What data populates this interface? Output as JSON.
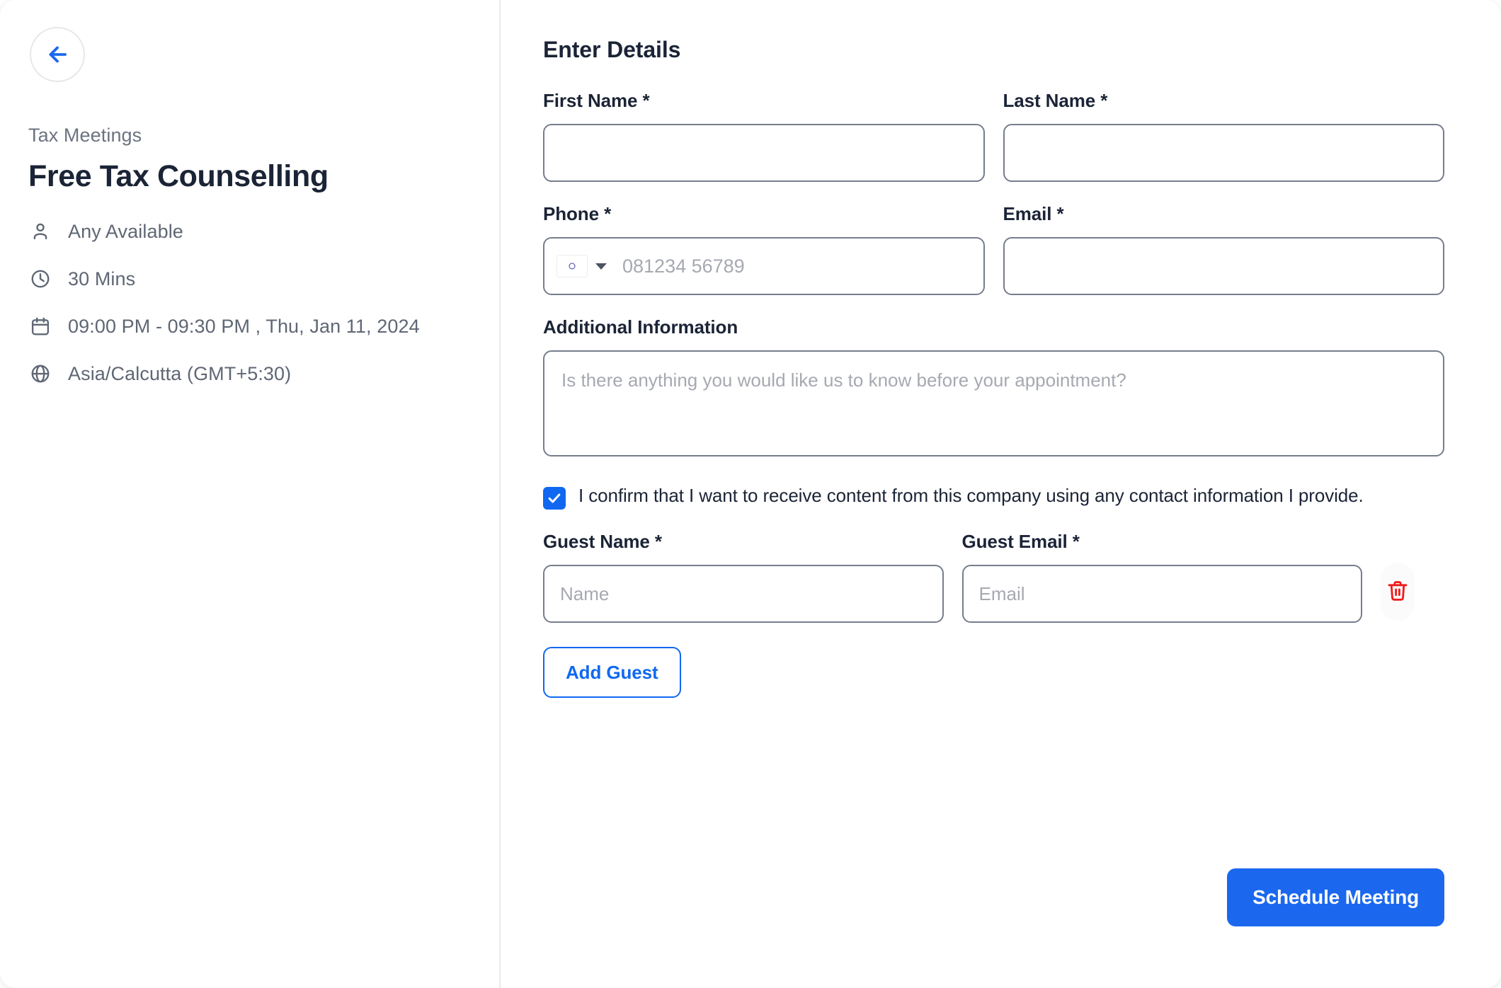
{
  "sidebar": {
    "back_icon": "arrow-left-icon",
    "organization": "Tax Meetings",
    "title": "Free Tax Counselling",
    "meta": [
      {
        "icon": "person-icon",
        "text": "Any Available"
      },
      {
        "icon": "clock-icon",
        "text": "30 Mins"
      },
      {
        "icon": "calendar-icon",
        "text": "09:00 PM - 09:30 PM , Thu, Jan 11, 2024"
      },
      {
        "icon": "globe-icon",
        "text": "Asia/Calcutta (GMT+5:30)"
      }
    ]
  },
  "form": {
    "heading": "Enter Details",
    "first_name": {
      "label": "First Name *",
      "value": "",
      "placeholder": ""
    },
    "last_name": {
      "label": "Last Name *",
      "value": "",
      "placeholder": ""
    },
    "phone": {
      "label": "Phone *",
      "value": "",
      "placeholder": "081234 56789",
      "country_flag": "india-flag-icon",
      "dropdown_icon": "chevron-down-icon"
    },
    "email": {
      "label": "Email *",
      "value": "",
      "placeholder": ""
    },
    "additional_information": {
      "label": "Additional Information",
      "value": "",
      "placeholder": "Is there anything you would like us to know before your appointment?"
    },
    "consent": {
      "checked": true,
      "text": "I confirm that I want to receive content from this company using any contact information I provide."
    },
    "guest": {
      "name_label": "Guest Name *",
      "name_value": "",
      "name_placeholder": "Name",
      "email_label": "Guest Email *",
      "email_value": "",
      "email_placeholder": "Email",
      "delete_icon": "trash-icon"
    },
    "add_guest_label": "Add Guest",
    "submit_label": "Schedule Meeting"
  },
  "colors": {
    "accent_blue": "#1b68ef",
    "link_blue": "#1068f0",
    "danger_red": "#ef1c1c",
    "text_dark": "#1b2436",
    "text_muted": "#5f6775",
    "border_gray": "#767d8c"
  }
}
